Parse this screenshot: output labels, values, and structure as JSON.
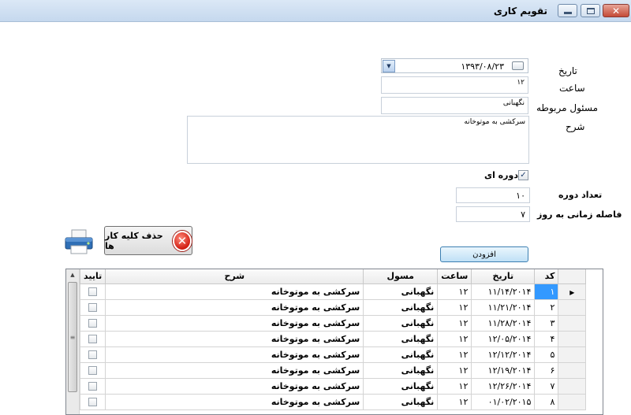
{
  "window": {
    "title": "تقویم کاری",
    "close_glyph": "✕"
  },
  "form": {
    "date_label": "تاریخ",
    "date_value": "۱۳۹۳/۰۸/۲۳",
    "time_label": "ساعت",
    "time_value": "۱۲",
    "responsible_label": "مسئول مربوطه",
    "responsible_value": "نگهبانی",
    "description_label": "شرح",
    "description_value": "سرکشی به موتوخانه",
    "periodic_label": "دوره ای",
    "periodic_checked": true,
    "period_count_label": "تعداد دوره",
    "period_count_value": "۱۰",
    "interval_label": "فاصله زمانی به روز",
    "interval_value": "۷",
    "add_button": "افزودن",
    "delete_all_button": "حذف کلیه کار ها",
    "icons": [
      "printer-icon",
      "delete-icon",
      "dropdown-arrow-icon"
    ]
  },
  "grid": {
    "headers": {
      "code": "کد",
      "date": "تاریخ",
      "time": "ساعت",
      "responsible": "مسول",
      "description": "شرح",
      "confirm": "تایید"
    },
    "rows": [
      {
        "code": "۱",
        "date": "۱۱/۱۴/۲۰۱۴",
        "time": "۱۲",
        "responsible": "نگهبانی",
        "description": "سرکشی به موتوخانه",
        "confirmed": false
      },
      {
        "code": "۲",
        "date": "۱۱/۲۱/۲۰۱۴",
        "time": "۱۲",
        "responsible": "نگهبانی",
        "description": "سرکشی به موتوخانه",
        "confirmed": false
      },
      {
        "code": "۳",
        "date": "۱۱/۲۸/۲۰۱۴",
        "time": "۱۲",
        "responsible": "نگهبانی",
        "description": "سرکشی به موتوخانه",
        "confirmed": false
      },
      {
        "code": "۴",
        "date": "۱۲/۰۵/۲۰۱۴",
        "time": "۱۲",
        "responsible": "نگهبانی",
        "description": "سرکشی به موتوخانه",
        "confirmed": false
      },
      {
        "code": "۵",
        "date": "۱۲/۱۲/۲۰۱۴",
        "time": "۱۲",
        "responsible": "نگهبانی",
        "description": "سرکشی به موتوخانه",
        "confirmed": false
      },
      {
        "code": "۶",
        "date": "۱۲/۱۹/۲۰۱۴",
        "time": "۱۲",
        "responsible": "نگهبانی",
        "description": "سرکشی به موتوخانه",
        "confirmed": false
      },
      {
        "code": "۷",
        "date": "۱۲/۲۶/۲۰۱۴",
        "time": "۱۲",
        "responsible": "نگهبانی",
        "description": "سرکشی به موتوخانه",
        "confirmed": false
      },
      {
        "code": "۸",
        "date": "۰۱/۰۲/۲۰۱۵",
        "time": "۱۲",
        "responsible": "نگهبانی",
        "description": "سرکشی به موتوخانه",
        "confirmed": false
      }
    ]
  }
}
